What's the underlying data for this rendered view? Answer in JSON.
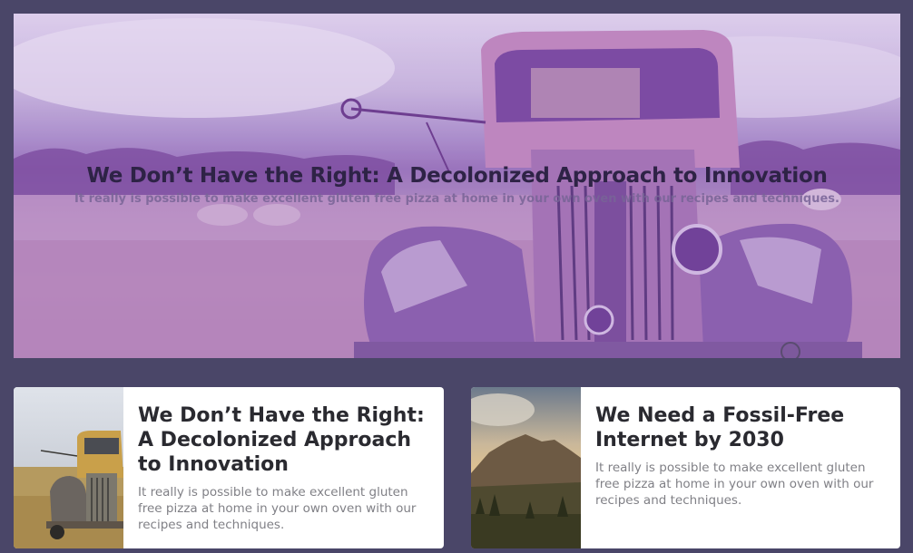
{
  "hero": {
    "title": "We Don’t Have the Right: A Decolonized Approach to Innovation",
    "subtitle": "It really is possible to make excellent gluten free pizza at home in your own oven with our recipes and techniques."
  },
  "cards": [
    {
      "title": "We Don’t Have the Right: A Decolonized Approach to Innovation",
      "text": "It really is possible to make excellent gluten free pizza at home in your own oven with our recipes and techniques."
    },
    {
      "title": "We Need a Fossil-Free Internet by 2030",
      "text": "It really is possible to make excellent gluten free pizza at home in your own oven with our recipes and techniques."
    }
  ],
  "colors": {
    "background": "#4a4668",
    "hero_tint": "#9d79bd",
    "card_bg": "#ffffff",
    "title_text": "#2a2a30",
    "body_text": "#808086"
  }
}
